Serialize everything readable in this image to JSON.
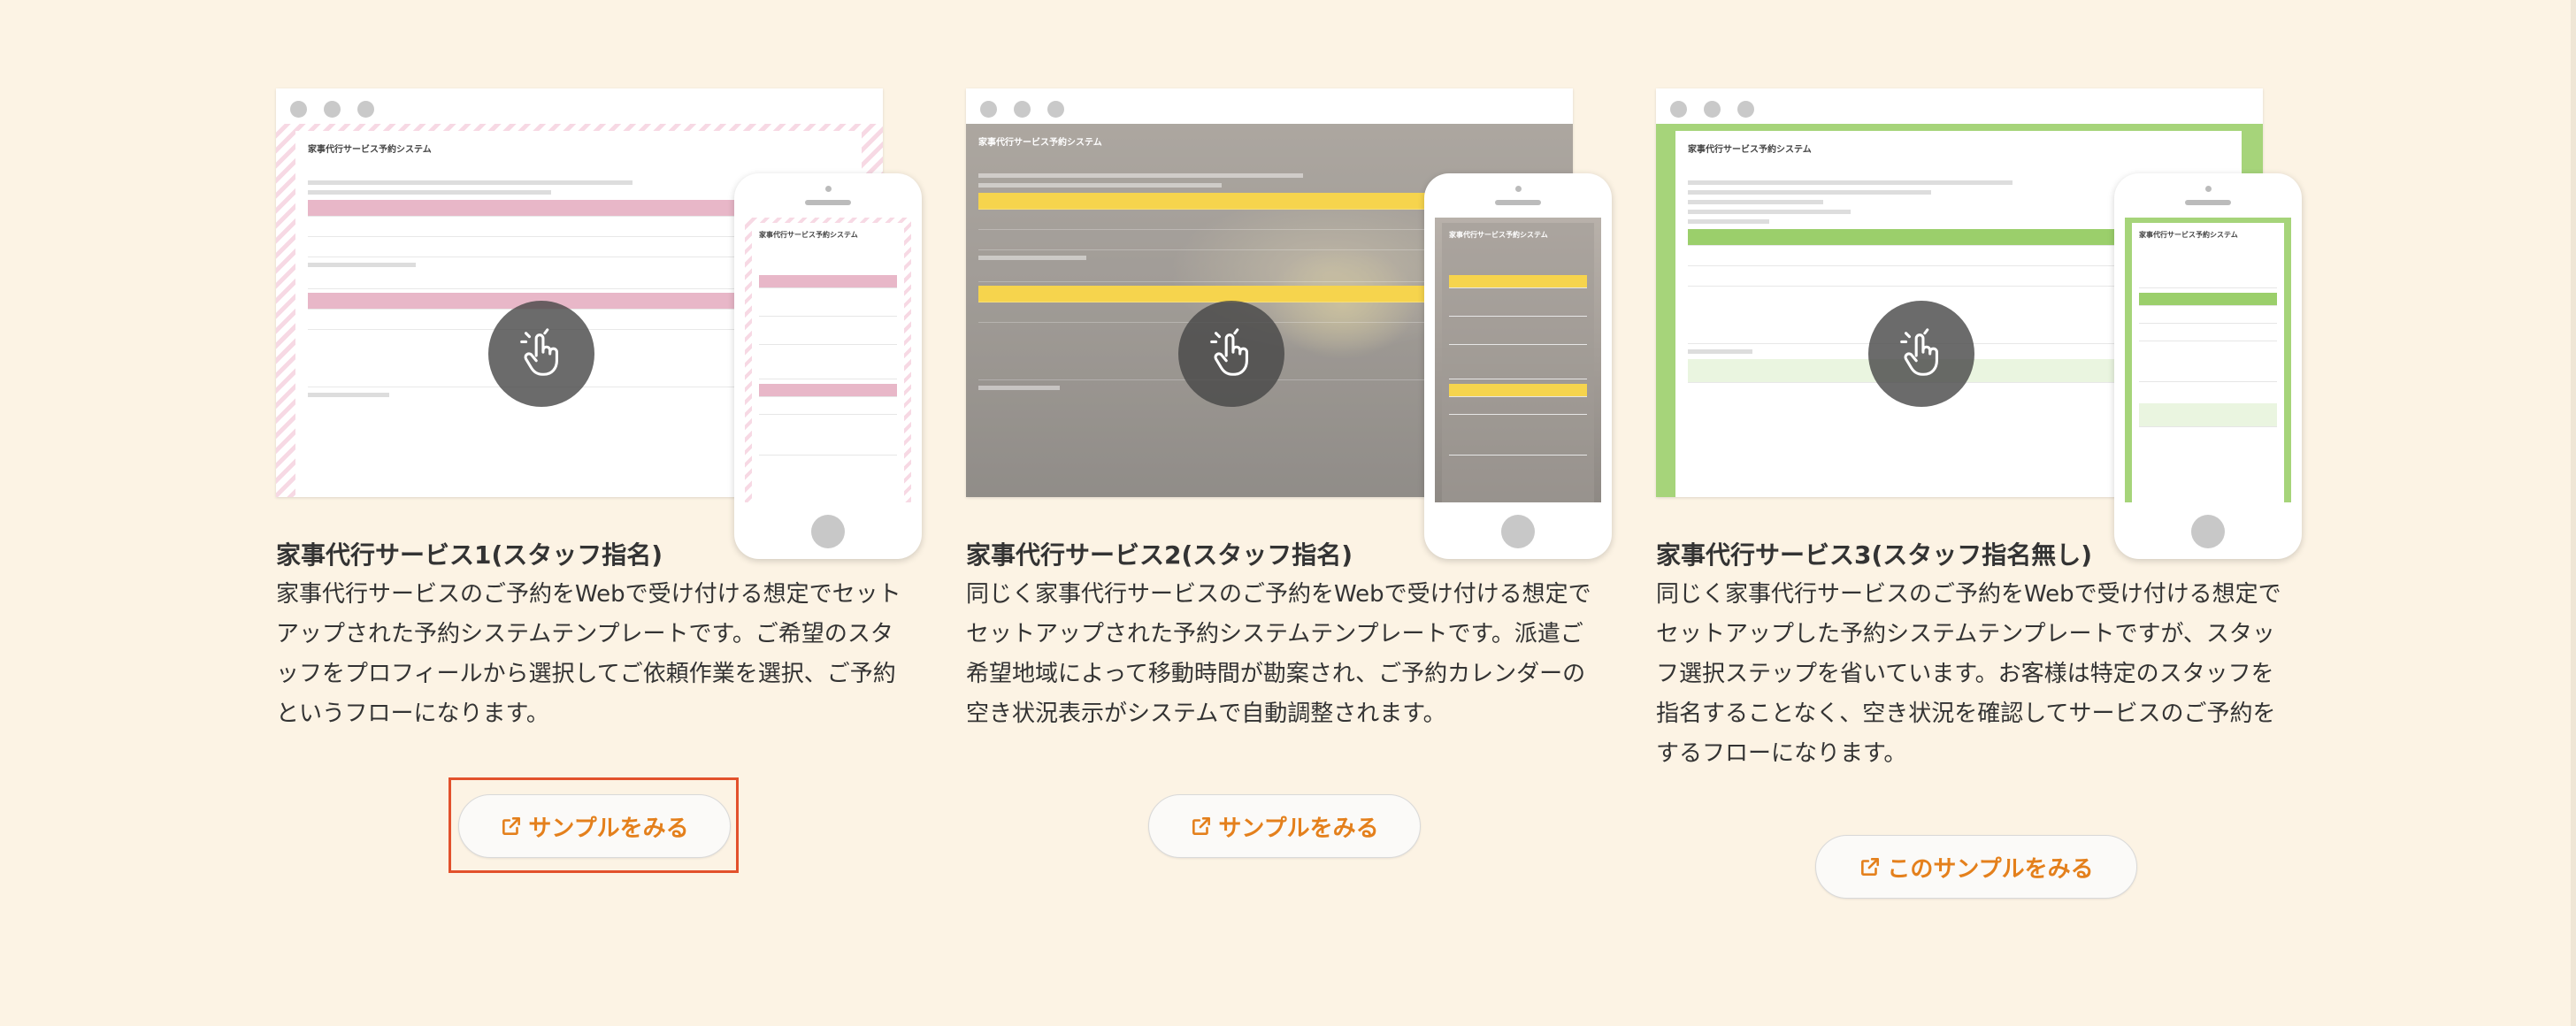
{
  "cards": [
    {
      "title": "家事代行サービス1(スタッフ指名)",
      "description": "家事代行サービスのご予約をWebで受け付ける想定でセットアップされた予約システムテンプレートです。ご希望のスタッフをプロフィールから選択してご依頼作業を選択、ご予約というフローになります。",
      "button_label": "サンプルをみる",
      "mock_title": "家事代行サービス予約システム",
      "theme": "pink"
    },
    {
      "title": "家事代行サービス2(スタッフ指名)",
      "description": "同じく家事代行サービスのご予約をWebで受け付ける想定でセットアップされた予約システムテンプレートです。派遣ご希望地域によって移動時間が勘案され、ご予約カレンダーの空き状況表示がシステムで自動調整されます。",
      "button_label": "サンプルをみる",
      "mock_title": "家事代行サービス予約システム",
      "theme": "photo"
    },
    {
      "title": "家事代行サービス3(スタッフ指名無し)",
      "description": "同じく家事代行サービスのご予約をWebで受け付ける想定でセットアップした予約システムテンプレートですが、スタッフ選択ステップを省いています。お客様は特定のスタッフを指名することなく、空き状況を確認してサービスのご予約をするフローになります。",
      "button_label": "このサンプルをみる",
      "mock_title": "家事代行サービス予約システム",
      "theme": "green"
    }
  ],
  "icons": {
    "tap": "tap-hand-icon",
    "external": "external-link-icon"
  },
  "colors": {
    "background": "#fcf3e4",
    "accent": "#e4801c",
    "focus": "#e2512c"
  }
}
